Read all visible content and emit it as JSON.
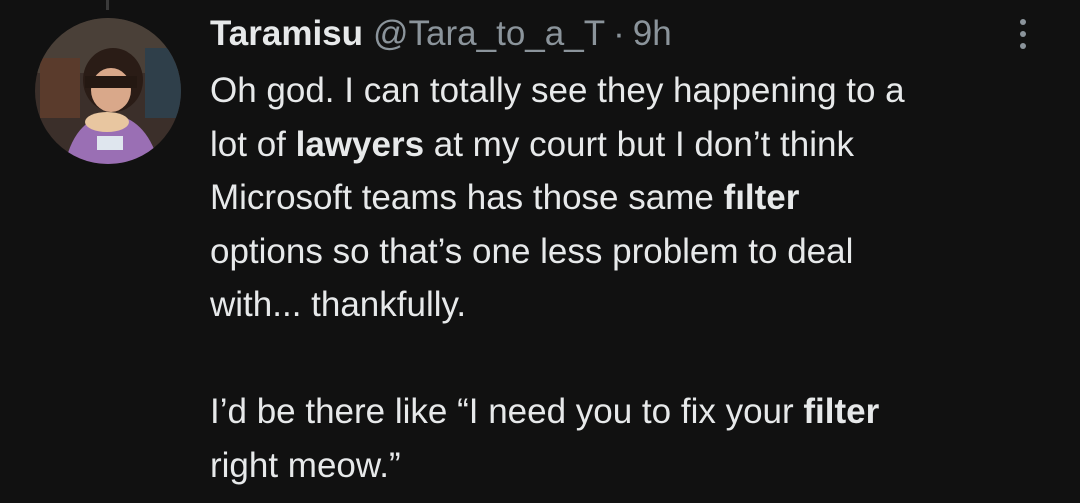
{
  "tweet": {
    "display_name": "Taramisu",
    "handle": "@Tara_to_a_T",
    "separator": "·",
    "time": "9h",
    "paragraph1": {
      "s1": "Oh god. I can totally see they happening to a",
      "s2": "lot of ",
      "b1": "lawyers",
      "s3": " at my court but I don’t think",
      "s4": "Microsoft teams has those same ",
      "b2": "fılter",
      "s5": "options so that’s one less problem to deal",
      "s6": "with... thankfully."
    },
    "paragraph2": {
      "s1": "I’d be there like “I need you to fix your ",
      "b1": "filter",
      "s2": "right meow.”"
    }
  },
  "icons": {
    "avatar": "profile-photo",
    "more": "more-vertical-icon"
  }
}
